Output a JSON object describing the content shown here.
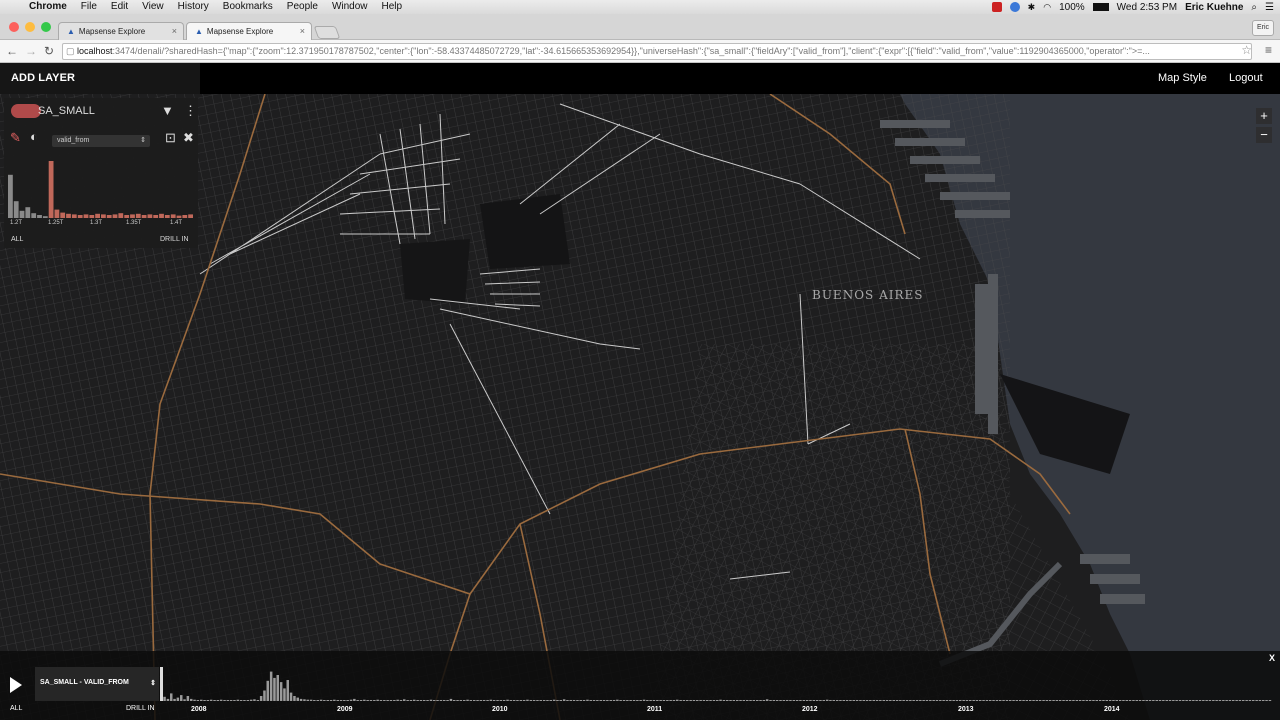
{
  "os_menubar": {
    "app": "Chrome",
    "items": [
      "File",
      "Edit",
      "View",
      "History",
      "Bookmarks",
      "People",
      "Window",
      "Help"
    ],
    "battery": "100%",
    "clock": "Wed 2:53 PM",
    "user": "Eric Kuehne"
  },
  "browser": {
    "tabs": [
      {
        "title": "Mapsense Explore",
        "active": false
      },
      {
        "title": "Mapsense Explore",
        "active": true
      }
    ],
    "profile_button": "Eric",
    "url_host": "localhost",
    "url_rest": ":3474/denali/?sharedHash={\"map\":{\"zoom\":12.371950178787502,\"center\":{\"lon\":-58.43374485072729,\"lat\":-34.615665353692954}},\"universeHash\":{\"sa_small\":{\"fieldAry\":[\"valid_from\"],\"client\":{\"expr\":[{\"field\":\"valid_from\",\"value\":1192904365000,\"operator\":\">=..."
  },
  "header": {
    "add_layer": "ADD LAYER",
    "map_style": "Map Style",
    "logout": "Logout"
  },
  "map": {
    "city_label": "BUENOS AIRES",
    "zoom_in": "+",
    "zoom_out": "−"
  },
  "layer_panel": {
    "name": "SA_SMALL",
    "swatch_color": "#b04a4a",
    "field": "valid_from",
    "ticks": [
      "1.2T",
      "1.25T",
      "1.3T",
      "1.35T",
      "1.4T"
    ],
    "all_link": "ALL",
    "drill_link": "DRILL IN",
    "histogram": [
      {
        "v": 0.72,
        "sel": false
      },
      {
        "v": 0.28,
        "sel": false
      },
      {
        "v": 0.12,
        "sel": false
      },
      {
        "v": 0.18,
        "sel": false
      },
      {
        "v": 0.08,
        "sel": false
      },
      {
        "v": 0.05,
        "sel": false
      },
      {
        "v": 0.03,
        "sel": false
      },
      {
        "v": 0.95,
        "sel": true
      },
      {
        "v": 0.14,
        "sel": true
      },
      {
        "v": 0.09,
        "sel": true
      },
      {
        "v": 0.07,
        "sel": true
      },
      {
        "v": 0.06,
        "sel": true
      },
      {
        "v": 0.05,
        "sel": true
      },
      {
        "v": 0.06,
        "sel": true
      },
      {
        "v": 0.05,
        "sel": true
      },
      {
        "v": 0.07,
        "sel": true
      },
      {
        "v": 0.06,
        "sel": true
      },
      {
        "v": 0.05,
        "sel": true
      },
      {
        "v": 0.06,
        "sel": true
      },
      {
        "v": 0.08,
        "sel": true
      },
      {
        "v": 0.05,
        "sel": true
      },
      {
        "v": 0.06,
        "sel": true
      },
      {
        "v": 0.07,
        "sel": true
      },
      {
        "v": 0.05,
        "sel": true
      },
      {
        "v": 0.06,
        "sel": true
      },
      {
        "v": 0.05,
        "sel": true
      },
      {
        "v": 0.07,
        "sel": true
      },
      {
        "v": 0.05,
        "sel": true
      },
      {
        "v": 0.06,
        "sel": true
      },
      {
        "v": 0.04,
        "sel": true
      },
      {
        "v": 0.05,
        "sel": true
      },
      {
        "v": 0.06,
        "sel": true
      }
    ]
  },
  "timeline": {
    "close": "X",
    "layer_field": "SA_SMALL - VALID_FROM",
    "all_link": "ALL",
    "drill_link": "DRILL IN",
    "years": [
      "2008",
      "2009",
      "2010",
      "2011",
      "2012",
      "2013",
      "2014"
    ],
    "bars": [
      0.06,
      0.1,
      0.05,
      0.18,
      0.05,
      0.08,
      0.14,
      0.04,
      0.12,
      0.05,
      0.03,
      0.02,
      0.03,
      0.02,
      0.02,
      0.03,
      0.02,
      0.02,
      0.03,
      0.02,
      0.02,
      0.02,
      0.02,
      0.03,
      0.02,
      0.02,
      0.02,
      0.03,
      0.04,
      0.02,
      0.12,
      0.25,
      0.48,
      0.7,
      0.55,
      0.62,
      0.45,
      0.3,
      0.5,
      0.2,
      0.12,
      0.08,
      0.05,
      0.04,
      0.03,
      0.03,
      0.02,
      0.02,
      0.03,
      0.02,
      0.02,
      0.02,
      0.03,
      0.02,
      0.02,
      0.02,
      0.02,
      0.03,
      0.05,
      0.02,
      0.02,
      0.03,
      0.02,
      0.02,
      0.02,
      0.03,
      0.02,
      0.02,
      0.02,
      0.02,
      0.02,
      0.03,
      0.02,
      0.04,
      0.02,
      0.02,
      0.03,
      0.02,
      0.02,
      0.02,
      0.02,
      0.03,
      0.02,
      0.02,
      0.02,
      0.02,
      0.02,
      0.05,
      0.02,
      0.02,
      0.02,
      0.02,
      0.03,
      0.02,
      0.02,
      0.02,
      0.02,
      0.02,
      0.02,
      0.03,
      0.02,
      0.02,
      0.02,
      0.02,
      0.03,
      0.02,
      0.02,
      0.02,
      0.02,
      0.02,
      0.03,
      0.02,
      0.02,
      0.02,
      0.02,
      0.02,
      0.02,
      0.02,
      0.03,
      0.02,
      0.02,
      0.04,
      0.02,
      0.02,
      0.02,
      0.02,
      0.02,
      0.02,
      0.03,
      0.02,
      0.02,
      0.02,
      0.02,
      0.02,
      0.02,
      0.02,
      0.02,
      0.03,
      0.02,
      0.02,
      0.02,
      0.02,
      0.02,
      0.02,
      0.02,
      0.03,
      0.02,
      0.02,
      0.02,
      0.02,
      0.02,
      0.02,
      0.02,
      0.02,
      0.02,
      0.03,
      0.02,
      0.02,
      0.02,
      0.02,
      0.02,
      0.02,
      0.02,
      0.02,
      0.02,
      0.02,
      0.02,
      0.02,
      0.03,
      0.02,
      0.02,
      0.02,
      0.02,
      0.02,
      0.02,
      0.02,
      0.02,
      0.02,
      0.02,
      0.02,
      0.02,
      0.02,
      0.04,
      0.02,
      0.02,
      0.02,
      0.02,
      0.02,
      0.02,
      0.02,
      0.02,
      0.02,
      0.02,
      0.02,
      0.02,
      0.02,
      0.02,
      0.02,
      0.02,
      0.02,
      0.03,
      0.02,
      0.02,
      0.02,
      0.02,
      0.02,
      0.02,
      0.02,
      0.02,
      0.02,
      0.02,
      0.02,
      0.02,
      0.02,
      0.02,
      0.02,
      0.02,
      0.02,
      0.02,
      0.02,
      0.02,
      0.02,
      0.02,
      0.02,
      0.02,
      0.02,
      0.02,
      0.02,
      0.02,
      0.02,
      0.02,
      0.02,
      0.02,
      0.02,
      0.02,
      0.02,
      0.02,
      0.02,
      0.02,
      0.02,
      0.02,
      0.02,
      0.02,
      0.02,
      0.02,
      0.02,
      0.02,
      0.02,
      0.02,
      0.02,
      0.02,
      0.02,
      0.02,
      0.02,
      0.02,
      0.02,
      0.02,
      0.02,
      0.02,
      0.02,
      0.02,
      0.02,
      0.02,
      0.02,
      0.02,
      0.02,
      0.02,
      0.02,
      0.02,
      0.02,
      0.02,
      0.02,
      0.02,
      0.02,
      0.02,
      0.02,
      0.02,
      0.02,
      0.02,
      0.02,
      0.02,
      0.02,
      0.02,
      0.02,
      0.02,
      0.02,
      0.02,
      0.02,
      0.02,
      0.02,
      0.02,
      0.02,
      0.02,
      0.02,
      0.02,
      0.02,
      0.02,
      0.02,
      0.02,
      0.02,
      0.02,
      0.02,
      0.02,
      0.02,
      0.02,
      0.02,
      0.02,
      0.02,
      0.02,
      0.02,
      0.02,
      0.02,
      0.02,
      0.02,
      0.02,
      0.02,
      0.02,
      0.02,
      0.02,
      0.02,
      0.02,
      0.02,
      0.02,
      0.02,
      0.02,
      0.02,
      0.02,
      0.02,
      0.02,
      0.02,
      0.02,
      0.02,
      0.02,
      0.02
    ]
  },
  "colors": {
    "road": "#c9a27c",
    "land": "#1c1c1d",
    "water": "#343840"
  }
}
